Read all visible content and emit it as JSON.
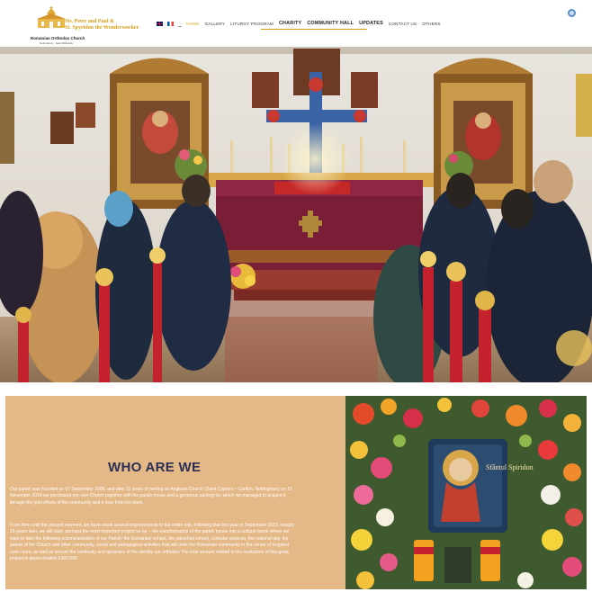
{
  "header": {
    "logo": {
      "line1": "Sts. Peter and Paul &",
      "line2": "St. Spyridon the Wonderworker",
      "line3": "Romanian Orthodox Church",
      "line4": "Nottingham · East Midlands"
    },
    "languages": [
      {
        "icon": "uk-flag-icon",
        "label": "English"
      },
      {
        "icon": "fr-flag-icon",
        "label": "Français"
      },
      {
        "icon": "ro-flag-icon",
        "label": "Română"
      }
    ],
    "nav": [
      {
        "label": "HOME",
        "active": true,
        "big": false
      },
      {
        "label": "GALLERY",
        "active": false,
        "big": false
      },
      {
        "label": "LITURGY PROGRAM",
        "active": false,
        "big": false
      },
      {
        "label": "CHARITY",
        "active": false,
        "big": true
      },
      {
        "label": "COMMUNITY HALL",
        "active": false,
        "big": true
      },
      {
        "label": "UPDATES",
        "active": false,
        "big": true
      },
      {
        "label": "CONTACT US",
        "active": false,
        "big": false
      },
      {
        "label": "OTHERS",
        "active": false,
        "big": false
      }
    ],
    "search_icon": "search-icon"
  },
  "hero": {
    "alt": "Church interior with worshippers"
  },
  "about": {
    "title": "WHO ARE WE",
    "p1": "Our parish was founded on 07 September 2008, and after 11 years of renting an Anglican Church (Saint Cyprien – Carlton, Nottingham) on 15 November 2019 we purchased our own Church together with the parish house and a generous parking lot, which we managed to acquire it through the joint efforts of the community and a loan from the bank.",
    "p2": "From then until the present moment, we have made several improvements to the entire site, following that this year in September 2023, exactly 15 years later, we will start, perhaps the most important project so far – the transformation of the parish house into a cultural home where we want to take the following actions/activities of our Parish: the Romanian school, the parochial school, consular services, the national day, the patron of the Church and other community, social and pedagogical activities that will unite the Romanian community in the center of England even more, as well as ensure the continuity and dynamics of the identity our orthodox The total amount related to the realization of this great project is approximately £400,000.",
    "icon_label": "Sfântul Spiridon",
    "colors": {
      "background": "#e4b887",
      "title": "#2a2f56",
      "accent": "#d4a017"
    }
  }
}
